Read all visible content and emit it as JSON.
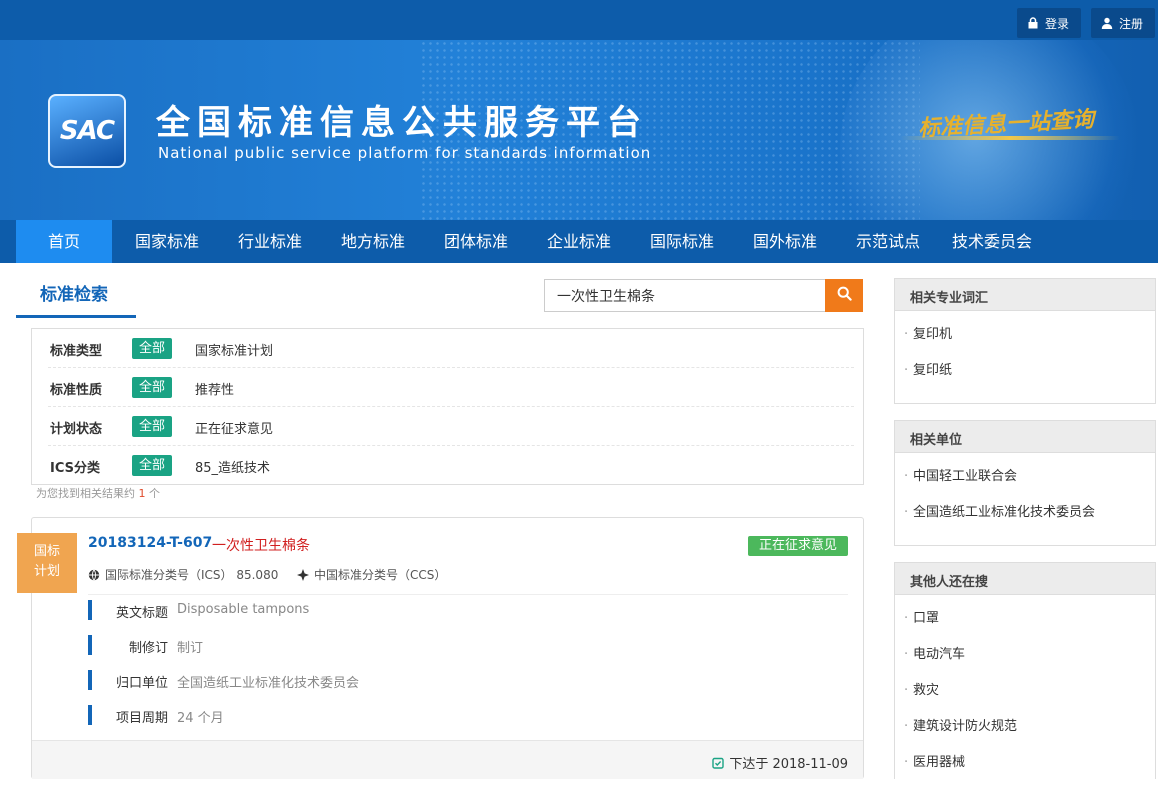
{
  "topbar": {
    "login": "登录",
    "register": "注册"
  },
  "banner": {
    "logo_text": "SAC",
    "title": "全国标准信息公共服务平台",
    "subtitle": "National public service platform  for standards information",
    "slogan": "标准信息一站查询"
  },
  "nav": [
    {
      "label": "首页"
    },
    {
      "label": "国家标准"
    },
    {
      "label": "行业标准"
    },
    {
      "label": "地方标准"
    },
    {
      "label": "团体标准"
    },
    {
      "label": "企业标准"
    },
    {
      "label": "国际标准"
    },
    {
      "label": "国外标准"
    },
    {
      "label": "示范试点"
    },
    {
      "label": "技术委员会"
    }
  ],
  "search": {
    "tab": "标准检索",
    "query": "一次性卫生棉条"
  },
  "filters": [
    {
      "label": "标准类型",
      "tag": "全部",
      "value": "国家标准计划"
    },
    {
      "label": "标准性质",
      "tag": "全部",
      "value": "推荐性"
    },
    {
      "label": "计划状态",
      "tag": "全部",
      "value": "正在征求意见"
    },
    {
      "label": "ICS分类",
      "tag": "全部",
      "value": "85_造纸技术"
    }
  ],
  "results_summary": {
    "prefix": "为您找到相关结果约",
    "count": "1",
    "suffix": "个"
  },
  "result": {
    "ribbon_line1": "国标",
    "ribbon_line2": "计划",
    "code": "20183124-T-607",
    "name": "一次性卫生棉条",
    "status": "正在征求意见",
    "ics": "国际标准分类号（ICS）  85.080",
    "ccs": "中国标准分类号（CCS）",
    "details": [
      {
        "key": "英文标题",
        "value": "Disposable tampons"
      },
      {
        "key": "制修订",
        "value": "制订"
      },
      {
        "key": "归口单位",
        "value": "全国造纸工业标准化技术委员会"
      },
      {
        "key": "项目周期",
        "value": "24 个月"
      }
    ],
    "issued": "下达于 2018-11-09"
  },
  "sidebar": {
    "terms": {
      "title": "相关专业词汇",
      "items": [
        "复印机",
        "复印纸"
      ]
    },
    "units": {
      "title": "相关单位",
      "items": [
        "中国轻工业联合会",
        "全国造纸工业标准化技术委员会"
      ]
    },
    "others": {
      "title": "其他人还在搜",
      "items": [
        "口罩",
        "电动汽车",
        "救灾",
        "建筑设计防火规范",
        "医用器械"
      ]
    }
  }
}
